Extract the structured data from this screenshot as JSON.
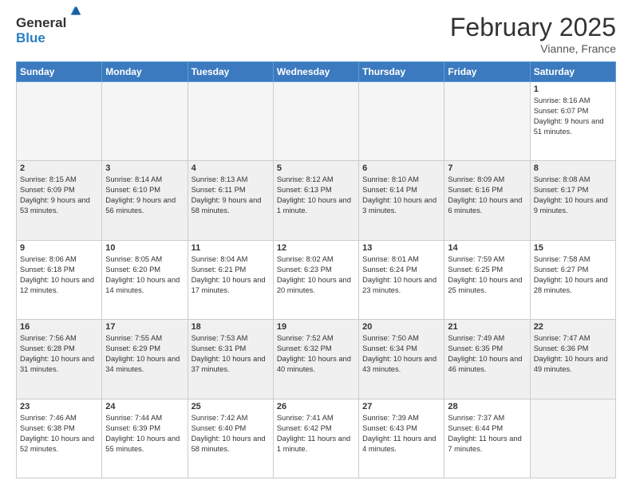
{
  "logo": {
    "general": "General",
    "blue": "Blue"
  },
  "header": {
    "month": "February 2025",
    "location": "Vianne, France"
  },
  "weekdays": [
    "Sunday",
    "Monday",
    "Tuesday",
    "Wednesday",
    "Thursday",
    "Friday",
    "Saturday"
  ],
  "weeks": [
    [
      {
        "day": "",
        "info": ""
      },
      {
        "day": "",
        "info": ""
      },
      {
        "day": "",
        "info": ""
      },
      {
        "day": "",
        "info": ""
      },
      {
        "day": "",
        "info": ""
      },
      {
        "day": "",
        "info": ""
      },
      {
        "day": "1",
        "info": "Sunrise: 8:16 AM\nSunset: 6:07 PM\nDaylight: 9 hours and 51 minutes."
      }
    ],
    [
      {
        "day": "2",
        "info": "Sunrise: 8:15 AM\nSunset: 6:09 PM\nDaylight: 9 hours and 53 minutes."
      },
      {
        "day": "3",
        "info": "Sunrise: 8:14 AM\nSunset: 6:10 PM\nDaylight: 9 hours and 56 minutes."
      },
      {
        "day": "4",
        "info": "Sunrise: 8:13 AM\nSunset: 6:11 PM\nDaylight: 9 hours and 58 minutes."
      },
      {
        "day": "5",
        "info": "Sunrise: 8:12 AM\nSunset: 6:13 PM\nDaylight: 10 hours and 1 minute."
      },
      {
        "day": "6",
        "info": "Sunrise: 8:10 AM\nSunset: 6:14 PM\nDaylight: 10 hours and 3 minutes."
      },
      {
        "day": "7",
        "info": "Sunrise: 8:09 AM\nSunset: 6:16 PM\nDaylight: 10 hours and 6 minutes."
      },
      {
        "day": "8",
        "info": "Sunrise: 8:08 AM\nSunset: 6:17 PM\nDaylight: 10 hours and 9 minutes."
      }
    ],
    [
      {
        "day": "9",
        "info": "Sunrise: 8:06 AM\nSunset: 6:18 PM\nDaylight: 10 hours and 12 minutes."
      },
      {
        "day": "10",
        "info": "Sunrise: 8:05 AM\nSunset: 6:20 PM\nDaylight: 10 hours and 14 minutes."
      },
      {
        "day": "11",
        "info": "Sunrise: 8:04 AM\nSunset: 6:21 PM\nDaylight: 10 hours and 17 minutes."
      },
      {
        "day": "12",
        "info": "Sunrise: 8:02 AM\nSunset: 6:23 PM\nDaylight: 10 hours and 20 minutes."
      },
      {
        "day": "13",
        "info": "Sunrise: 8:01 AM\nSunset: 6:24 PM\nDaylight: 10 hours and 23 minutes."
      },
      {
        "day": "14",
        "info": "Sunrise: 7:59 AM\nSunset: 6:25 PM\nDaylight: 10 hours and 25 minutes."
      },
      {
        "day": "15",
        "info": "Sunrise: 7:58 AM\nSunset: 6:27 PM\nDaylight: 10 hours and 28 minutes."
      }
    ],
    [
      {
        "day": "16",
        "info": "Sunrise: 7:56 AM\nSunset: 6:28 PM\nDaylight: 10 hours and 31 minutes."
      },
      {
        "day": "17",
        "info": "Sunrise: 7:55 AM\nSunset: 6:29 PM\nDaylight: 10 hours and 34 minutes."
      },
      {
        "day": "18",
        "info": "Sunrise: 7:53 AM\nSunset: 6:31 PM\nDaylight: 10 hours and 37 minutes."
      },
      {
        "day": "19",
        "info": "Sunrise: 7:52 AM\nSunset: 6:32 PM\nDaylight: 10 hours and 40 minutes."
      },
      {
        "day": "20",
        "info": "Sunrise: 7:50 AM\nSunset: 6:34 PM\nDaylight: 10 hours and 43 minutes."
      },
      {
        "day": "21",
        "info": "Sunrise: 7:49 AM\nSunset: 6:35 PM\nDaylight: 10 hours and 46 minutes."
      },
      {
        "day": "22",
        "info": "Sunrise: 7:47 AM\nSunset: 6:36 PM\nDaylight: 10 hours and 49 minutes."
      }
    ],
    [
      {
        "day": "23",
        "info": "Sunrise: 7:46 AM\nSunset: 6:38 PM\nDaylight: 10 hours and 52 minutes."
      },
      {
        "day": "24",
        "info": "Sunrise: 7:44 AM\nSunset: 6:39 PM\nDaylight: 10 hours and 55 minutes."
      },
      {
        "day": "25",
        "info": "Sunrise: 7:42 AM\nSunset: 6:40 PM\nDaylight: 10 hours and 58 minutes."
      },
      {
        "day": "26",
        "info": "Sunrise: 7:41 AM\nSunset: 6:42 PM\nDaylight: 11 hours and 1 minute."
      },
      {
        "day": "27",
        "info": "Sunrise: 7:39 AM\nSunset: 6:43 PM\nDaylight: 11 hours and 4 minutes."
      },
      {
        "day": "28",
        "info": "Sunrise: 7:37 AM\nSunset: 6:44 PM\nDaylight: 11 hours and 7 minutes."
      },
      {
        "day": "",
        "info": ""
      }
    ]
  ]
}
